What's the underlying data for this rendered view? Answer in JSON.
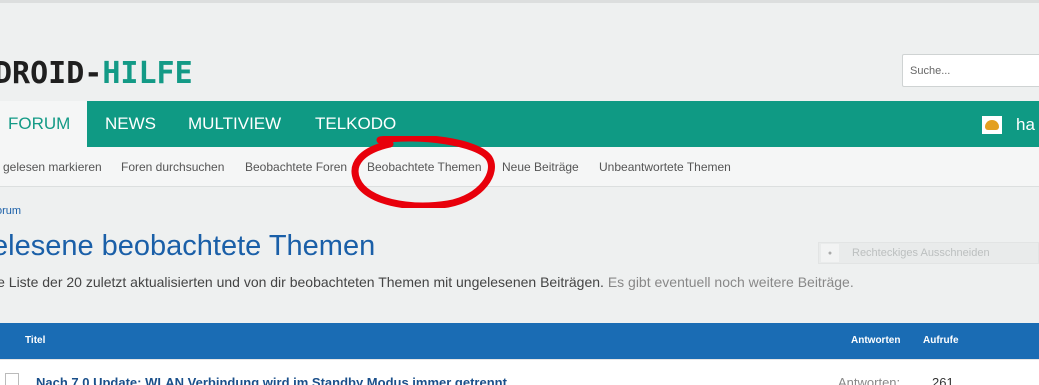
{
  "header": {
    "logo_part1": "DROID-",
    "logo_part2": "HILFE",
    "search_placeholder": "Suche..."
  },
  "nav": {
    "tabs": [
      {
        "label": "FORUM",
        "active": true
      },
      {
        "label": "NEWS",
        "active": false
      },
      {
        "label": "MULTIVIEW",
        "active": false
      },
      {
        "label": "TELKODO",
        "active": false
      }
    ],
    "username": "ha"
  },
  "subnav": {
    "items": [
      {
        "label": "gelesen markieren"
      },
      {
        "label": "Foren durchsuchen"
      },
      {
        "label": "Beobachtete Foren"
      },
      {
        "label": "Beobachtete Themen"
      },
      {
        "label": "Neue Beiträge"
      },
      {
        "label": "Unbeantwortete Themen"
      }
    ]
  },
  "breadcrumb": {
    "label": "orum"
  },
  "page": {
    "title": "elesene beobachtete Themen",
    "description": "ie Liste der 20 zuletzt aktualisierten und von dir beobachteten Themen mit ungelesenen Beiträgen.",
    "description_muted": "Es gibt eventuell noch weitere Beiträge."
  },
  "snip_widget": {
    "label": "Rechteckiges Ausschneiden"
  },
  "table": {
    "headers": {
      "title": "Titel",
      "replies": "Antworten",
      "views": "Aufrufe"
    },
    "rows": [
      {
        "title": "Nach 7.0 Update: WLAN Verbindung wird im Standby Modus immer getrennt",
        "replies_label": "Antworten:",
        "replies": "261"
      }
    ]
  },
  "colors": {
    "brand_teal": "#0f9a84",
    "link_blue": "#1a5fa8",
    "table_head": "#1a6cb4",
    "annotation_red": "#e8000b"
  }
}
